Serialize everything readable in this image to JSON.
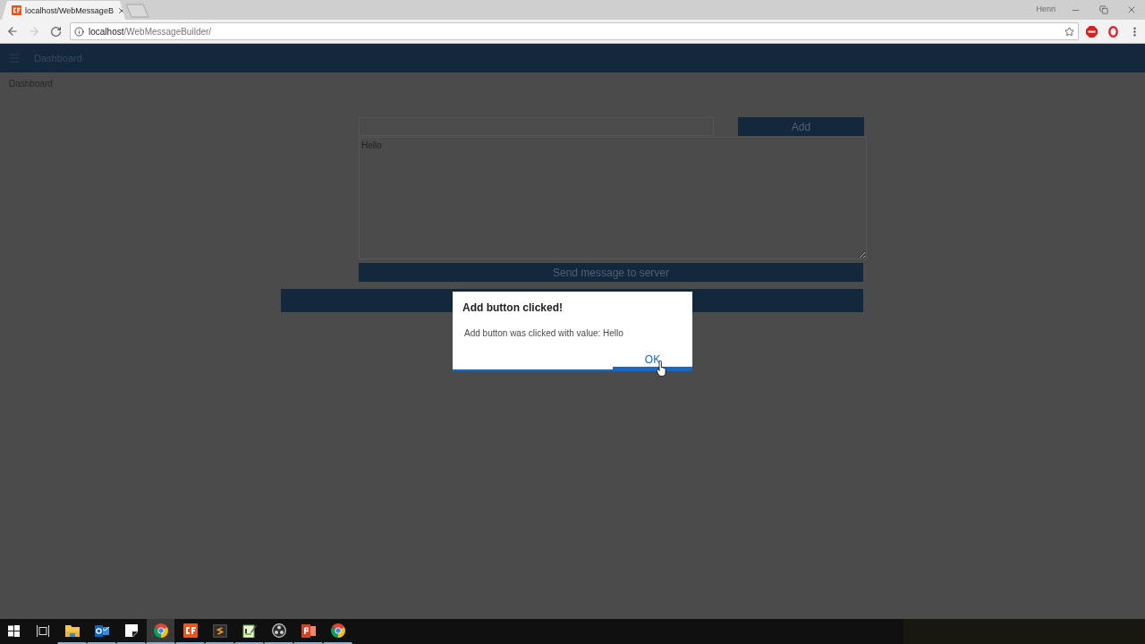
{
  "browser": {
    "tabs": [
      {
        "title": "localhost/WebMessageB",
        "selected": true
      }
    ],
    "profile": "Henri",
    "nav": [
      {
        "kind": "back",
        "disabled": false
      },
      {
        "kind": "forward",
        "disabled": true
      },
      {
        "kind": "reload",
        "disabled": false
      }
    ],
    "address": {
      "host": "localhost",
      "path": "/WebMessageBuilder/"
    }
  },
  "app_bar": {
    "title": "Dashboard"
  },
  "breadcrumb": "Dashboard",
  "form": {
    "add_button": "Add",
    "message": "Hello",
    "send_button": "Send message to server"
  },
  "dialog": {
    "title": "Add button clicked!",
    "message": "Add button was clicked with value: Hello",
    "ok_button": "OK"
  },
  "taskbar": {
    "items": [
      {
        "kind": "start",
        "selected": false,
        "running": false
      },
      {
        "kind": "task-view",
        "selected": false,
        "running": false
      },
      {
        "kind": "folder",
        "selected": false,
        "running": true
      },
      {
        "kind": "mail",
        "selected": false,
        "running": true
      },
      {
        "kind": "note",
        "selected": false,
        "running": true
      },
      {
        "kind": "browser",
        "selected": true,
        "running": true
      },
      {
        "kind": "logo",
        "selected": false,
        "running": true
      },
      {
        "kind": "editor",
        "selected": false,
        "running": true
      },
      {
        "kind": "notepad",
        "selected": false,
        "running": true
      },
      {
        "kind": "recorder",
        "selected": false,
        "running": true
      },
      {
        "kind": "slides",
        "selected": false,
        "running": true
      },
      {
        "kind": "browser",
        "selected": false,
        "running": true
      }
    ]
  }
}
